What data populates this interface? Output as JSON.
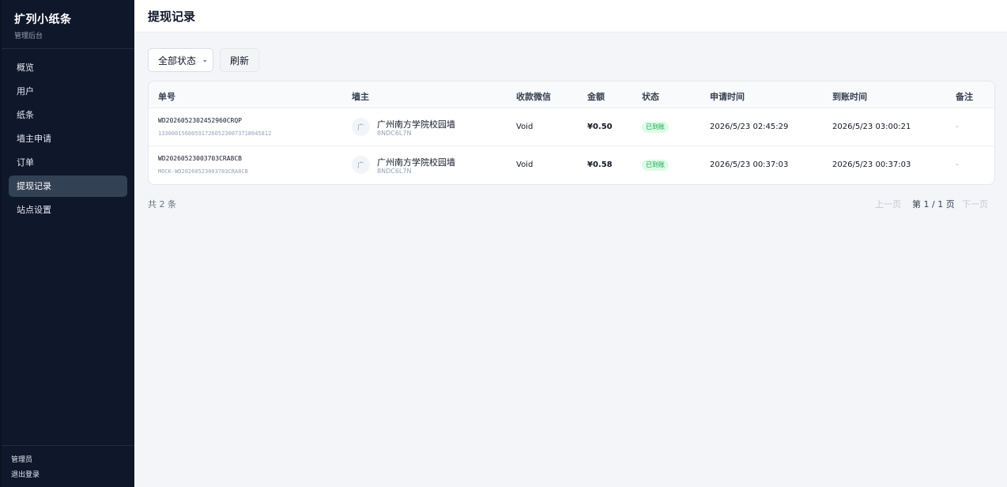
{
  "sidebar": {
    "brand_title": "扩列小纸条",
    "brand_sub": "管理后台",
    "items": [
      {
        "label": "概览"
      },
      {
        "label": "用户"
      },
      {
        "label": "纸条"
      },
      {
        "label": "墙主申请"
      },
      {
        "label": "订单"
      },
      {
        "label": "提现记录"
      },
      {
        "label": "站点设置"
      }
    ],
    "active_index": 5,
    "footer_role": "管理员",
    "footer_logout": "退出登录"
  },
  "header": {
    "title": "提现记录"
  },
  "toolbar": {
    "filter_value": "全部状态",
    "refresh_label": "刷新"
  },
  "table": {
    "columns": [
      "单号",
      "墙主",
      "收款微信",
      "金额",
      "状态",
      "申请时间",
      "到账时间",
      "备注"
    ],
    "rows": [
      {
        "order_no": "WD2026052302452960CRQP",
        "order_sub": "1330001560059172605230073718045812",
        "avatar_char": "广",
        "owner_name": "广州南方学院校园墙",
        "owner_id": "8NDC6L7N",
        "wechat": "Void",
        "amount": "¥0.50",
        "status": "已到账",
        "applied_at": "2026/5/23 02:45:29",
        "arrived_at": "2026/5/23 03:00:21",
        "note": "-"
      },
      {
        "order_no": "WD20260523003703CRA8CB",
        "order_sub": "MOCK-WD20260523003703CRA8CB",
        "avatar_char": "广",
        "owner_name": "广州南方学院校园墙",
        "owner_id": "8NDC6L7N",
        "wechat": "Void",
        "amount": "¥0.58",
        "status": "已到账",
        "applied_at": "2026/5/23 00:37:03",
        "arrived_at": "2026/5/23 00:37:03",
        "note": "-"
      }
    ]
  },
  "footer": {
    "total": "共 2 条",
    "prev": "上一页",
    "page_info": "第 1 / 1 页",
    "next": "下一页"
  },
  "colors": {
    "sidebar_bg": "#0f172a",
    "active_bg": "#334155",
    "badge_bg": "#dcfce7",
    "badge_text": "#16a34a"
  }
}
